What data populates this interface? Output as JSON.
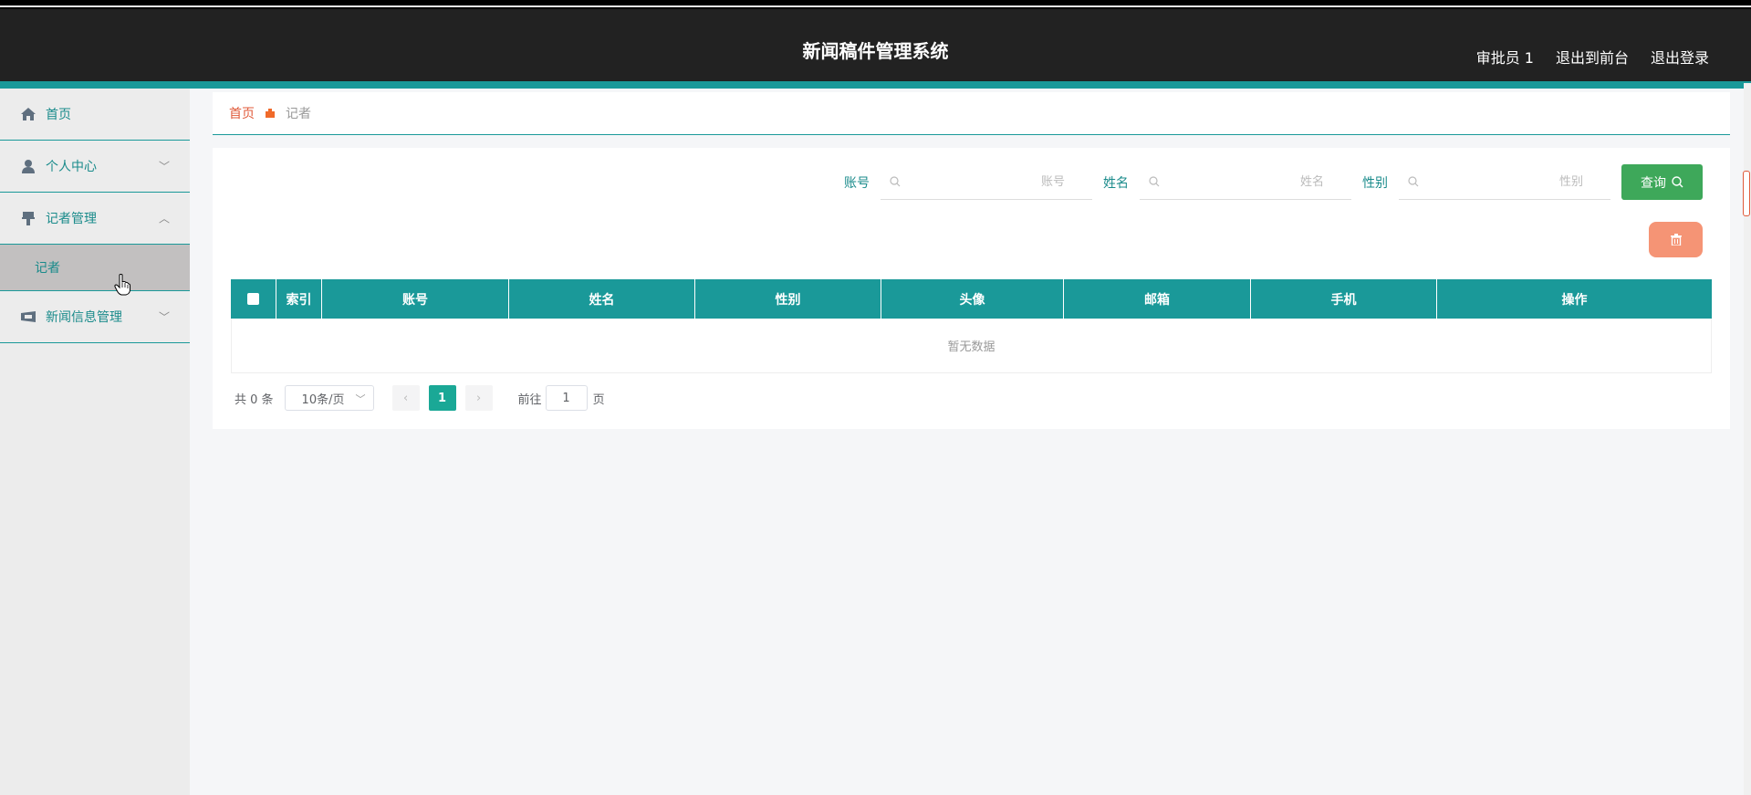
{
  "app": {
    "title": "新闻稿件管理系统"
  },
  "header": {
    "links": [
      "审批员 1",
      "退出到前台",
      "退出登录"
    ]
  },
  "sidebar": {
    "items": [
      {
        "label": "首页",
        "icon": "home-icon"
      },
      {
        "label": "个人中心",
        "icon": "user-icon"
      },
      {
        "label": "记者管理",
        "icon": "reporter-icon",
        "expanded": true,
        "children": [
          "记者"
        ]
      },
      {
        "label": "新闻信息管理",
        "icon": "news-icon"
      }
    ]
  },
  "breadcrumb": {
    "home": "首页",
    "current": "记者"
  },
  "search": {
    "fields": [
      {
        "label": "账号",
        "placeholder": "账号"
      },
      {
        "label": "姓名",
        "placeholder": "姓名"
      },
      {
        "label": "性别",
        "placeholder": "性别"
      }
    ],
    "query_label": "查询"
  },
  "table": {
    "columns": [
      "索引",
      "账号",
      "姓名",
      "性别",
      "头像",
      "邮箱",
      "手机",
      "操作"
    ],
    "empty_text": "暂无数据"
  },
  "pagination": {
    "total_text": "共 0 条",
    "page_size": "10条/页",
    "current_page": "1",
    "goto_label": "前往",
    "goto_value": "1",
    "page_unit": "页"
  },
  "colors": {
    "accent": "#1a9999",
    "header": "#222222",
    "query": "#3ea85a",
    "delete": "#f59475"
  }
}
